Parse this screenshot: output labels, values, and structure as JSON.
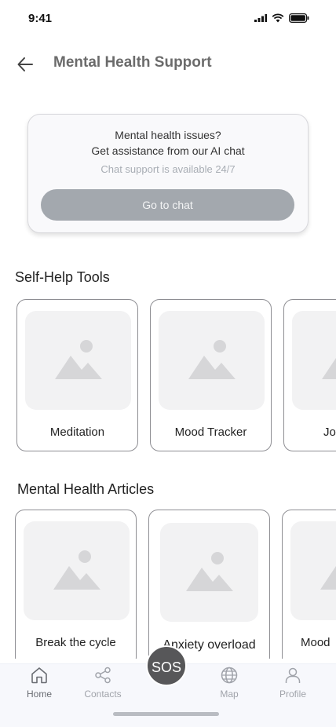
{
  "status": {
    "time": "9:41"
  },
  "header": {
    "title": "Mental Health Support",
    "back_icon": "arrow-left-icon"
  },
  "chat_card": {
    "line1": "Mental health issues?",
    "line2": "Get assistance from our AI chat",
    "availability": "Chat support is available 24/7",
    "button_label": "Go to chat"
  },
  "self_help": {
    "title": "Self-Help Tools",
    "items": [
      {
        "label": "Meditation"
      },
      {
        "label": "Mood Tracker"
      },
      {
        "label": "Jo"
      }
    ]
  },
  "articles": {
    "title": "Mental Health Articles",
    "items": [
      {
        "label": "Break the cycle"
      },
      {
        "label": "Anxiety overload"
      },
      {
        "label": "Mood"
      }
    ]
  },
  "sos": {
    "label": "SOS"
  },
  "nav": {
    "items": [
      {
        "label": "Home",
        "icon": "home-icon",
        "active": true
      },
      {
        "label": "Contacts",
        "icon": "share-icon",
        "active": false
      },
      {
        "label": "Map",
        "icon": "globe-icon",
        "active": false
      },
      {
        "label": "Profile",
        "icon": "user-icon",
        "active": false
      }
    ]
  },
  "colors": {
    "button_gray": "#a3a8ae",
    "sos_bg": "#575759",
    "nav_bg": "#f7f8fc",
    "placeholder_bg": "#f2f2f3"
  }
}
